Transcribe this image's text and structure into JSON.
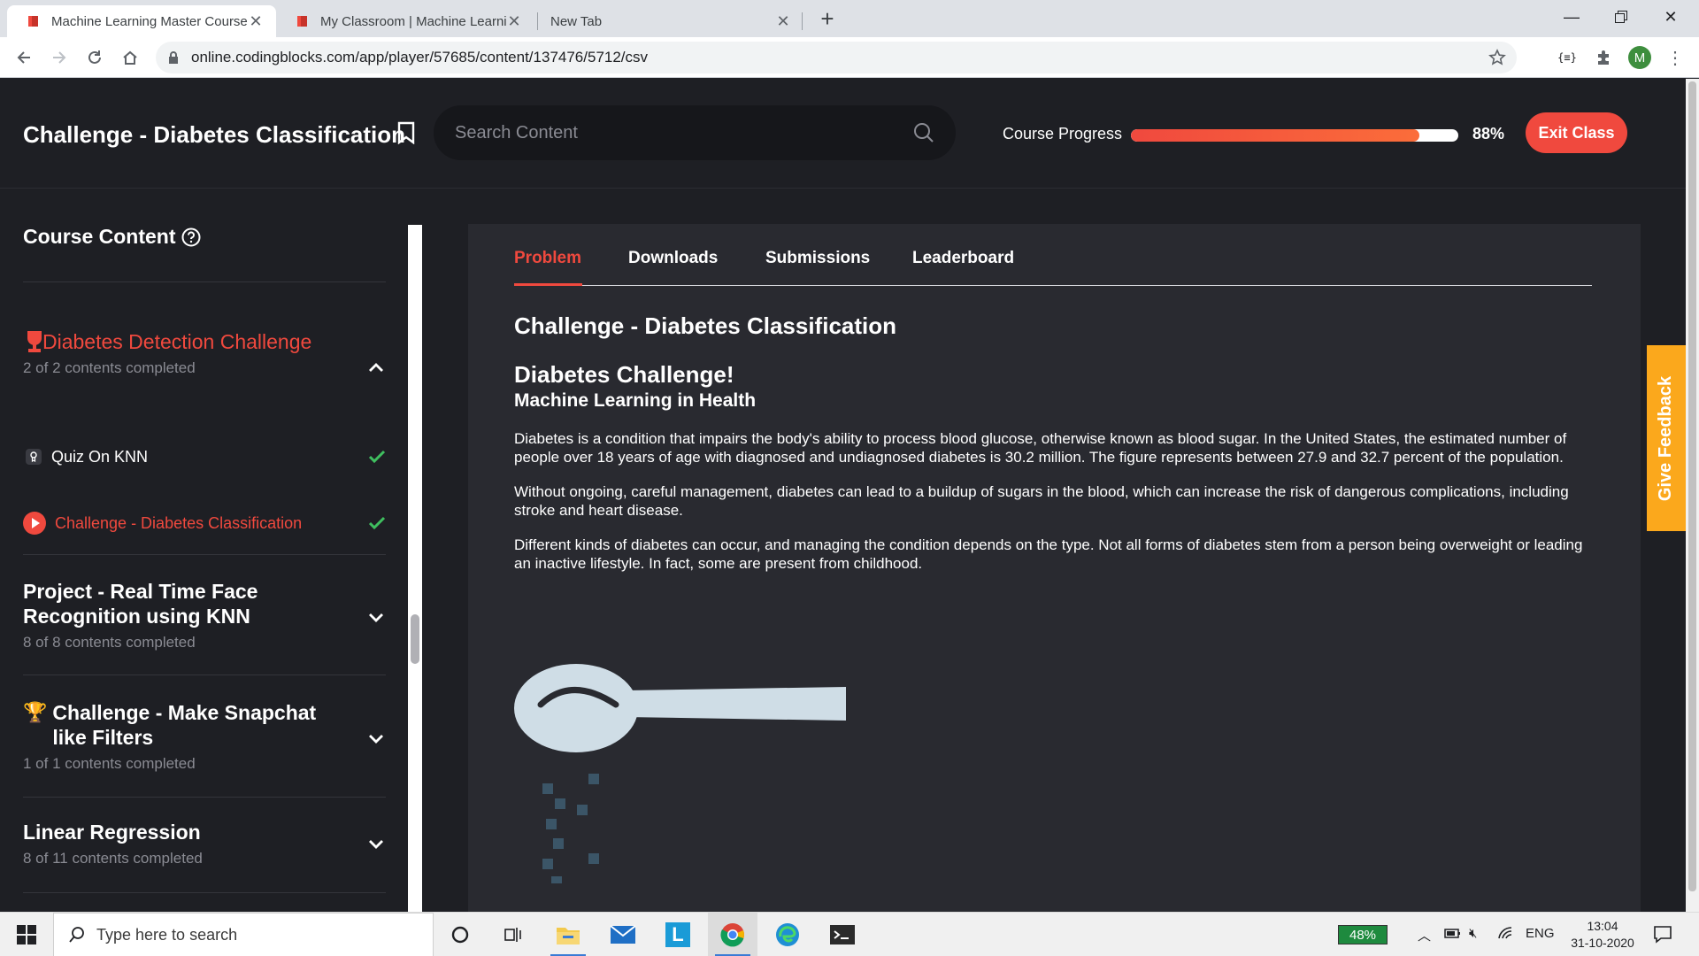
{
  "browser": {
    "tabs": [
      {
        "title": "Machine Learning Master Course",
        "active": true
      },
      {
        "title": "My Classroom | Machine Learning",
        "active": false
      },
      {
        "title": "New Tab",
        "active": false
      }
    ],
    "url": "online.codingblocks.com/app/player/57685/content/137476/5712/csv",
    "profile_initial": "M"
  },
  "header": {
    "title": "Challenge - Diabetes Classification",
    "search_placeholder": "Search Content",
    "progress_label": "Course Progress",
    "progress_value": 0.88,
    "progress_text": "88%",
    "exit_label": "Exit Class"
  },
  "sidebar": {
    "title": "Course Content",
    "sections": [
      {
        "title": "Diabetes Detection Challenge",
        "subtitle": "2 of 2 contents completed",
        "expanded": true,
        "active": true
      },
      {
        "title": "Project - Real Time Face Recognition using KNN",
        "subtitle": "8 of 8 contents completed",
        "expanded": false
      },
      {
        "title": "Challenge - Make Snapchat like Filters",
        "subtitle": "1 of 1 contents completed",
        "expanded": false
      },
      {
        "title": "Linear Regression",
        "subtitle": "8 of 11 contents completed",
        "expanded": false
      }
    ],
    "lessons": [
      {
        "title": "Quiz On KNN",
        "completed": true,
        "active": false
      },
      {
        "title": "Challenge - Diabetes Classification",
        "completed": true,
        "active": true
      }
    ]
  },
  "content_tabs": [
    {
      "label": "Problem",
      "active": true
    },
    {
      "label": "Downloads",
      "active": false
    },
    {
      "label": "Submissions",
      "active": false
    },
    {
      "label": "Leaderboard",
      "active": false
    }
  ],
  "problem": {
    "title": "Challenge - Diabetes Classification",
    "heading": "Diabetes Challenge!",
    "subheading": "Machine Learning in Health",
    "paragraphs": [
      "Diabetes is a condition that impairs the body's ability to process blood glucose, otherwise known as blood sugar. In the United States, the estimated number of people over 18 years of age with diagnosed and undiagnosed diabetes is 30.2 million. The figure represents between 27.9 and 32.7 percent of the population.",
      "Without ongoing, careful management, diabetes can lead to a buildup of sugars in the blood, which can increase the risk of dangerous complications, including stroke and heart disease.",
      "Different kinds of diabetes can occur, and managing the condition depends on the type. Not all forms of diabetes stem from a person being overweight or leading an inactive lifestyle. In fact, some are present from childhood."
    ]
  },
  "feedback_label": "Give Feedback",
  "taskbar": {
    "search_placeholder": "Type here to search",
    "battery": "48%",
    "language": "ENG",
    "time": "13:04",
    "date": "31-10-2020"
  },
  "colors": {
    "accent": "#f0493e",
    "feedback": "#fba81c",
    "success": "#3fbf5f",
    "background": "#1e1f24",
    "panel": "#292a30"
  }
}
